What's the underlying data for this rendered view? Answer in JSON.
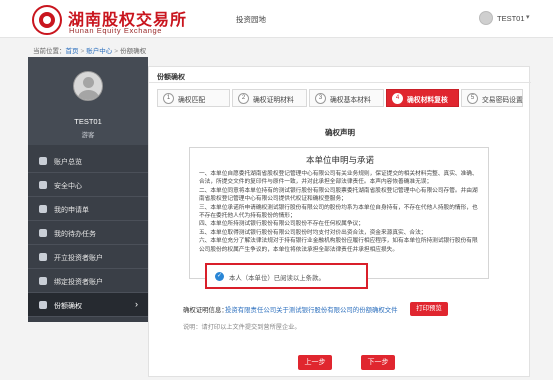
{
  "brand": {
    "name_cn": "湖南股权交易所",
    "name_en": "Hunan Equity Exchange"
  },
  "header": {
    "nav_link": "投资园地",
    "username": "TEST01",
    "caret": "▾"
  },
  "breadcrumb": {
    "label": "当前位置：",
    "items": [
      "首页",
      "账户中心",
      "份额确权"
    ],
    "sep": ">"
  },
  "sidebar": {
    "name": "TEST01",
    "role": "游客",
    "items": [
      {
        "label": "账户总览",
        "icon": "monitor-icon"
      },
      {
        "label": "安全中心",
        "icon": "shield-icon"
      },
      {
        "label": "我的申请单",
        "icon": "document-icon"
      },
      {
        "label": "我的待办任务",
        "icon": "tasks-icon"
      },
      {
        "label": "开立投资者账户",
        "icon": "account-icon"
      },
      {
        "label": "绑定投资者账户",
        "icon": "link-icon"
      },
      {
        "label": "份额确权",
        "icon": "share-icon",
        "active": true,
        "arrow": "›"
      }
    ]
  },
  "main": {
    "title": "份额确权",
    "steps": [
      {
        "num": "1",
        "label": "确权匹配"
      },
      {
        "num": "2",
        "label": "确权证明材料"
      },
      {
        "num": "3",
        "label": "确权基本材料"
      },
      {
        "num": "4",
        "label": "确权材料复核",
        "active": true
      },
      {
        "num": "5",
        "label": "交易密码设置"
      }
    ],
    "section_title": "确权声明",
    "declaration": {
      "title": "本单位申明与承诺",
      "lines": [
        "一、本单位自愿委托湖南省股权登记管理中心有限公司有关业务规则，保证提交的相关材料完整、真实、准确、合法，所提交文件的复印件与原件一致，并对此承担全部法律责任。本声内容恢善确准无误；",
        "二、本单位同意将本单位持有的测试银行股份有限公司股票委托湖南省股权登记管理中心有限公司存管。并由湖南省股权登记管理中心有限公司提供代权证和确权登服务；",
        "三、本单位承诺所申请确权测试银行股份有限公司的股份均系为本单位自身持有，不存在代他人持股的情形，也不存在委托他人代为持有股份的情形；",
        "四、本单位所持测试银行股份有限公司股份不存在任何权属争议；",
        "五、本单位取得测试银行股份有限公司股份时均支付对价出资合法，资金来源真实、合法；",
        "六、本单位充分了解法律法规对于持有银行业金融机构股份应履行相应程序，如有本单位所持测试银行股份有限公司股份的权属产生争议的，本单位将依法承担全部法律责任并承担相应损失。"
      ]
    },
    "agree_text": "本人（本单位）已阅读以上条款。",
    "check_mark": "✓",
    "letter_label": "确权证明信息：",
    "letter_link": "投资有限责任公司关于测试银行股份有限公司的份额确权文件",
    "print_button": "打印预览",
    "note": "说明：请打印以上文件提交到营所屋企业。",
    "prev_button": "上一步",
    "next_button": "下一步"
  },
  "colors": {
    "accent": "#e0262f",
    "brand": "#c9151e",
    "sidebar_bg": "#3a3f47",
    "link": "#2a6ebd"
  }
}
